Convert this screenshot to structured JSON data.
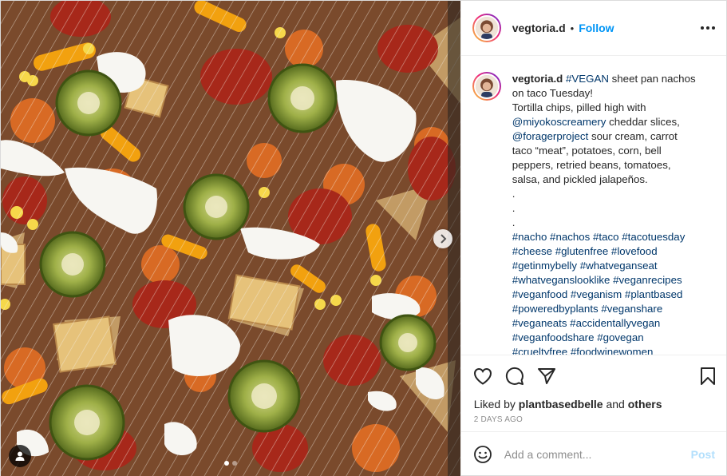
{
  "post": {
    "username": "vegtoria.d",
    "separator": "•",
    "follow_label": "Follow",
    "more_icon": "more-options-icon"
  },
  "caption": {
    "username": "vegtoria.d",
    "line1_tag": "#VEGAN",
    "line1_text": " sheet pan nachos on taco Tuesday!",
    "line2": "Tortilla chips, pilled high with",
    "mention1": "@miyokoscreamery",
    "line3": " cheddar slices,",
    "mention2": "@foragerproject",
    "line4": " sour cream, carrot taco “meat”, potatoes, corn, bell peppers, retried beans, tomatoes, salsa, and pickled jalapeños.",
    "dots": [
      ".",
      ".",
      "."
    ],
    "hashtags": "#nacho #nachos #taco #tacotuesday #cheese #glutenfree #lovefood #getinmybelly #whatveganseat #whatveganslooklike #veganrecipes #veganfood #veganism #plantbased #poweredbyplants #veganshare #veganeats #accidentallyvegan #veganfoodshare #govegan #crueltyfree #foodwinewomen"
  },
  "likes": {
    "prefix": "Liked by ",
    "user": "plantbasedbelle",
    "middle": " and ",
    "others": "others"
  },
  "timestamp": "2 DAYS AGO",
  "comment": {
    "placeholder": "Add a comment...",
    "post_label": "Post"
  },
  "carousel": {
    "slide_count": 2,
    "active_index": 0
  },
  "colors": {
    "accent": "#0095f6",
    "link": "#00376b",
    "post_disabled": "#b2dffc"
  }
}
